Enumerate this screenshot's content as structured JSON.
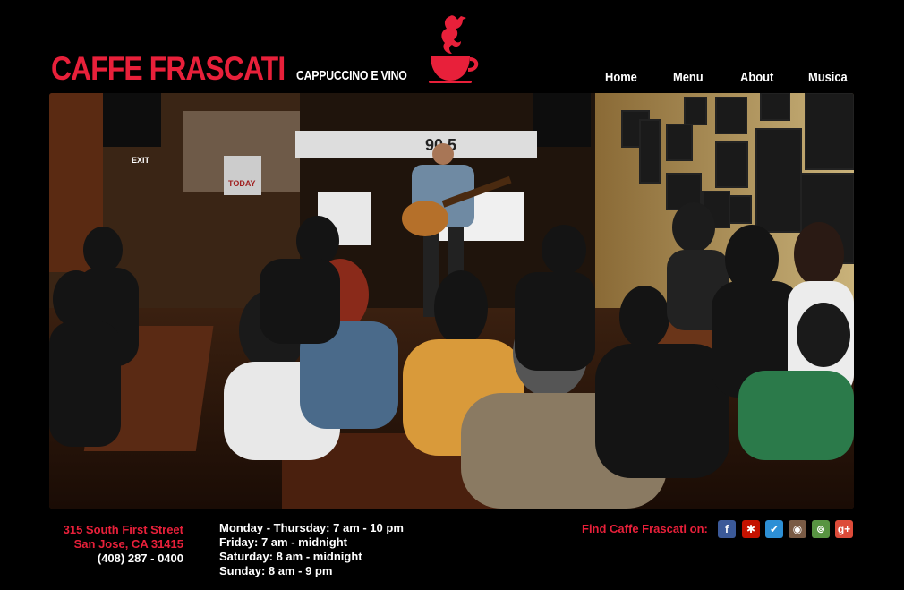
{
  "brand": {
    "name": "CAFFE FRASCATI",
    "tagline": "CAPPUCCINO E VINO"
  },
  "nav": {
    "items": [
      {
        "label": "Home"
      },
      {
        "label": "Menu"
      },
      {
        "label": "About"
      },
      {
        "label": "Musica"
      }
    ]
  },
  "hero": {
    "banner_text": "90.5",
    "sign_text": "TODAY",
    "exit_sign": "EXIT"
  },
  "footer": {
    "address": [
      "315 South First Street",
      "San Jose, CA 31415",
      "(408) 287 - 0400"
    ],
    "hours": [
      "Monday - Thursday: 7 am - 10 pm",
      "Friday: 7 am - midnight",
      "Saturday: 8 am - midnight",
      "Sunday: 8 am - 9 pm"
    ],
    "find_label": "Find Caffe Frascati on:"
  },
  "social": [
    {
      "icon": "facebook-icon",
      "glyph": "f",
      "color": "#3b5998"
    },
    {
      "icon": "yelp-icon",
      "glyph": "✱",
      "color": "#c41200"
    },
    {
      "icon": "foursquare-icon",
      "glyph": "✔",
      "color": "#2d8fd5"
    },
    {
      "icon": "instagram-icon",
      "glyph": "◉",
      "color": "#7a5b45"
    },
    {
      "icon": "tripadvisor-icon",
      "glyph": "⊚",
      "color": "#589442"
    },
    {
      "icon": "google-plus-icon",
      "glyph": "g+",
      "color": "#dd4b39"
    }
  ],
  "colors": {
    "accent": "#e8203a",
    "background": "#000000"
  }
}
